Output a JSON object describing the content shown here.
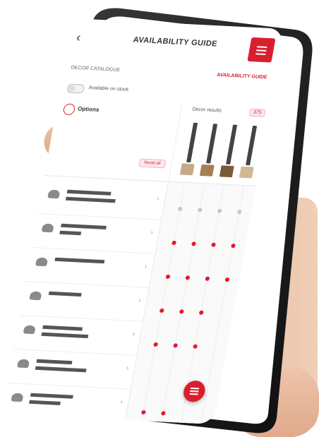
{
  "app": {
    "title": "AVAILABILITY GUIDE",
    "back_icon": "chevron-left-icon",
    "menu_icon": "hamburger-menu-icon"
  },
  "header": {
    "decor_catalogue": "DECOR CATALOGUE",
    "availability_guide": "AVAILABILITY GUIDE"
  },
  "filters": {
    "stock_toggle_label": "Available on stock",
    "options_label": "Options",
    "reset_label": "Reset all",
    "decor_results_label": "Decor results",
    "decor_results_count": "375"
  },
  "swatches": [
    {
      "color": "#c4ab88"
    },
    {
      "color": "#a57e56"
    },
    {
      "color": "#7b5a39"
    },
    {
      "color": "#d1b995"
    }
  ],
  "list": {
    "items": [
      {
        "icon": "product-icon"
      },
      {
        "icon": "product-icon"
      },
      {
        "icon": "product-icon"
      },
      {
        "icon": "product-icon"
      },
      {
        "icon": "product-icon"
      },
      {
        "icon": "product-icon"
      },
      {
        "icon": "product-icon"
      }
    ]
  },
  "fab": {
    "icon": "filter-icon"
  },
  "colors": {
    "accent": "#d91f2f",
    "phone_frame": "#1c1c1e",
    "skin": "#e9b89b"
  }
}
